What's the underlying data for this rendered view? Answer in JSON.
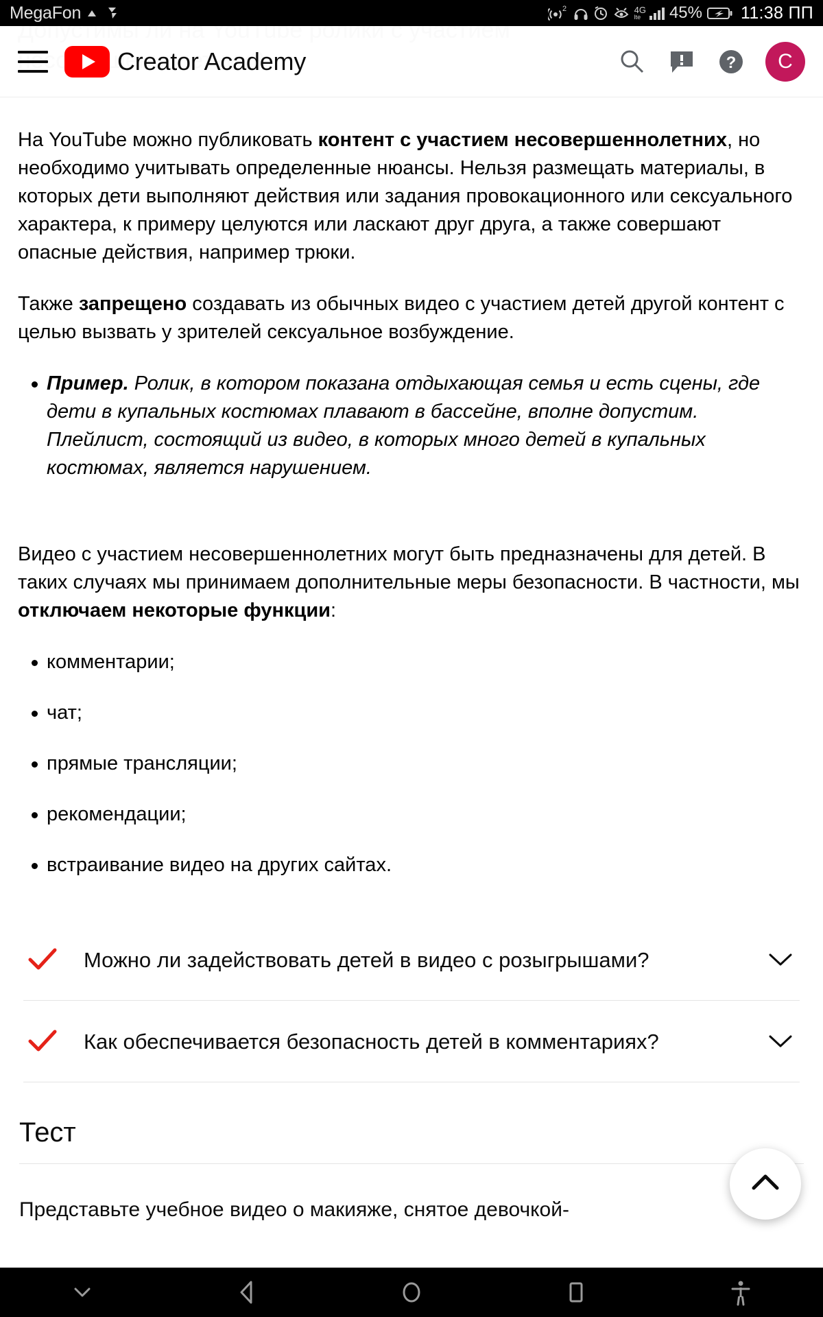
{
  "statusbar": {
    "carrier": "MegaFon",
    "battery_percent": "45%",
    "network_gen": "4G",
    "network_sub": "lte",
    "time": "11:38 ПП",
    "icons": [
      "cast-icon",
      "sync-icon",
      "hotspot-icon",
      "headphones-icon",
      "alarm-icon",
      "eye-care-icon",
      "signal-bars-icon",
      "battery-charging-icon"
    ]
  },
  "header": {
    "menu_icon": "hamburger-menu-icon",
    "logo_icon": "youtube-logo-icon",
    "brand": "Creator Academy",
    "search_icon": "search-icon",
    "feedback_icon": "feedback-icon",
    "help_icon": "help-icon",
    "avatar_letter": "C",
    "avatar_color": "#c2185b",
    "ghost_title": "Допустимы ли на YouTube ролики с участием\nнесовершеннолетних?"
  },
  "article": {
    "p1_a": "На YouTube можно публиковать ",
    "p1_bold": "контент с участием несовершеннолетних",
    "p1_b": ", но необходимо учитывать определенные нюансы. Нельзя размещать материалы, в которых дети выполняют действия или задания провокационного или сексуального характера, к примеру целуются или ласкают друг друга, а также совершают опасные действия, например трюки.",
    "p2_a": "Также ",
    "p2_bold": "запрещено",
    "p2_b": " создавать из обычных видео с участием детей другой контент с целью вызвать у зрителей сексуальное возбуждение.",
    "example_lead": "Пример.",
    "example_text": " Ролик, в котором показана отдыхающая семья и есть сцены, где дети в купальных костюмах плавают в бассейне, вполне допустим. Плейлист, состоящий из видео, в которых много детей в купальных костюмах, является нарушением.",
    "p3_a": "Видео с участием несовершеннолетних могут быть предназначены для детей. В таких случаях мы принимаем дополнительные меры безопасности. В частности, мы ",
    "p3_bold": "отключаем некоторые функции",
    "p3_b": ":",
    "features": [
      "комментарии;",
      "чат;",
      "прямые трансляции;",
      "рекомендации;",
      "встраивание видео на других сайтах."
    ]
  },
  "faq": {
    "check_icon": "check-icon",
    "check_color": "#e52218",
    "chevron_icon": "chevron-down-icon",
    "items": [
      {
        "title": "Можно ли задействовать детей в видео с розыгрышами?"
      },
      {
        "title": "Как обеспечивается безопасность детей в комментариях?"
      }
    ]
  },
  "test": {
    "heading": "Тест",
    "question": "Представьте учебное видео о макияже, снятое девочкой-"
  },
  "fab": {
    "icon": "chevron-up-icon"
  },
  "navbar": {
    "buttons": [
      {
        "icon": "hide-nav-chevron-down-icon"
      },
      {
        "icon": "back-triangle-icon"
      },
      {
        "icon": "home-circle-icon"
      },
      {
        "icon": "recents-square-icon"
      },
      {
        "icon": "accessibility-icon"
      }
    ]
  }
}
